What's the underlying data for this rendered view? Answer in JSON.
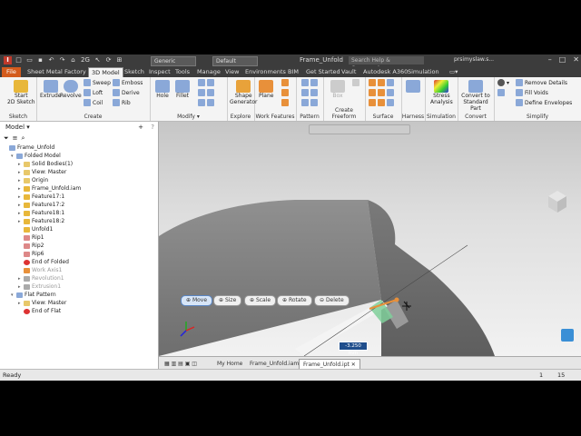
{
  "titlebar": {
    "doc_title": "Frame_Unfold",
    "search_placeholder": "Search Help & Commands...",
    "user": "prsimyslaw.s...",
    "material": "Generic",
    "appearance": "Default",
    "undo_count": "2G"
  },
  "tabs": [
    "File",
    "Sheet Metal",
    "Factory",
    "3D Model",
    "Sketch",
    "Inspect",
    "Tools",
    "Manage",
    "View",
    "Environments",
    "BIM",
    "Get Started",
    "Vault",
    "Autodesk A360",
    "Simulation"
  ],
  "active_tab": "3D Model",
  "ribbon": {
    "sketch": {
      "label": "Sketch",
      "start": "Start",
      "start2": "2D Sketch"
    },
    "create": {
      "label": "Create",
      "extrude": "Extrude",
      "revolve": "Revolve",
      "sweep": "Sweep",
      "loft": "Loft",
      "coil": "Coil",
      "emboss": "Emboss",
      "derive": "Derive",
      "rib": "Rib"
    },
    "modify": {
      "label": "Modify",
      "hole": "Hole",
      "fillet": "Fillet"
    },
    "explore": {
      "label": "Explore",
      "shape": "Shape",
      "generator": "Generator"
    },
    "work": {
      "label": "Work Features",
      "plane": "Plane"
    },
    "pattern": {
      "label": "Pattern"
    },
    "freeform": {
      "label": "Create Freeform",
      "box": "Box"
    },
    "surface": {
      "label": "Surface"
    },
    "harness": {
      "label": "Harness"
    },
    "simulation": {
      "label": "Simulation",
      "stress": "Stress",
      "analysis": "Analysis"
    },
    "convert": {
      "label": "Convert",
      "c1": "Convert to",
      "c2": "Standard Part"
    },
    "simplify": {
      "label": "Simplify",
      "remove": "Remove Details",
      "fill": "Fill Voids",
      "define": "Define Envelopes"
    }
  },
  "browser": {
    "title": "Model",
    "items": [
      {
        "label": "Frame_Unfold",
        "indent": 0,
        "exp": "",
        "icon": "part",
        "dim": false
      },
      {
        "label": "Folded Model",
        "indent": 1,
        "exp": "▾",
        "icon": "part",
        "dim": false
      },
      {
        "label": "Solid Bodies(1)",
        "indent": 2,
        "exp": "▸",
        "icon": "folder",
        "dim": false
      },
      {
        "label": "View: Master",
        "indent": 2,
        "exp": "▸",
        "icon": "view",
        "dim": false
      },
      {
        "label": "Origin",
        "indent": 2,
        "exp": "▸",
        "icon": "folder",
        "dim": false
      },
      {
        "label": "Frame_Unfold.iam",
        "indent": 2,
        "exp": "▸",
        "icon": "asm",
        "dim": false
      },
      {
        "label": "Feature17:1",
        "indent": 2,
        "exp": "▸",
        "icon": "asm",
        "dim": false
      },
      {
        "label": "Feature17:2",
        "indent": 2,
        "exp": "▸",
        "icon": "asm",
        "dim": false
      },
      {
        "label": "Feature18:1",
        "indent": 2,
        "exp": "▸",
        "icon": "asm",
        "dim": false
      },
      {
        "label": "Feature18:2",
        "indent": 2,
        "exp": "▸",
        "icon": "asm",
        "dim": false
      },
      {
        "label": "Unfold1",
        "indent": 2,
        "exp": "",
        "icon": "unfold",
        "dim": false
      },
      {
        "label": "Rip1",
        "indent": 2,
        "exp": "",
        "icon": "rip",
        "dim": false
      },
      {
        "label": "Rip2",
        "indent": 2,
        "exp": "",
        "icon": "rip",
        "dim": false
      },
      {
        "label": "Rip6",
        "indent": 2,
        "exp": "",
        "icon": "rip",
        "dim": false
      },
      {
        "label": "End of Folded",
        "indent": 2,
        "exp": "",
        "icon": "end",
        "dim": false
      },
      {
        "label": "Work Axis1",
        "indent": 2,
        "exp": "",
        "icon": "axis",
        "dim": true
      },
      {
        "label": "Revolution1",
        "indent": 2,
        "exp": "▸",
        "icon": "rev",
        "dim": true
      },
      {
        "label": "Extrusion1",
        "indent": 2,
        "exp": "▸",
        "icon": "rev",
        "dim": true
      },
      {
        "label": "Flat Pattern",
        "indent": 1,
        "exp": "▾",
        "icon": "flat",
        "dim": false
      },
      {
        "label": "View: Master",
        "indent": 2,
        "exp": "▸",
        "icon": "view",
        "dim": false
      },
      {
        "label": "End of Flat",
        "indent": 2,
        "exp": "",
        "icon": "end",
        "dim": false
      }
    ]
  },
  "minitoolbar": {
    "move": "Move",
    "size": "Size",
    "scale": "Scale",
    "rotate": "Rotate",
    "delete": "Delete"
  },
  "dimension": "-3.250 mm",
  "doc_tabs": [
    "My Home",
    "Frame_Unfold.iam",
    "Frame_Unfold.ipt"
  ],
  "active_doc_tab": "Frame_Unfold.ipt",
  "status": {
    "text": "Ready",
    "n1": "1",
    "n2": "15"
  },
  "colors": {
    "file_tab": "#d35b1d",
    "titlebar": "#3c3c3c",
    "select_green": "#7fcf9a"
  }
}
